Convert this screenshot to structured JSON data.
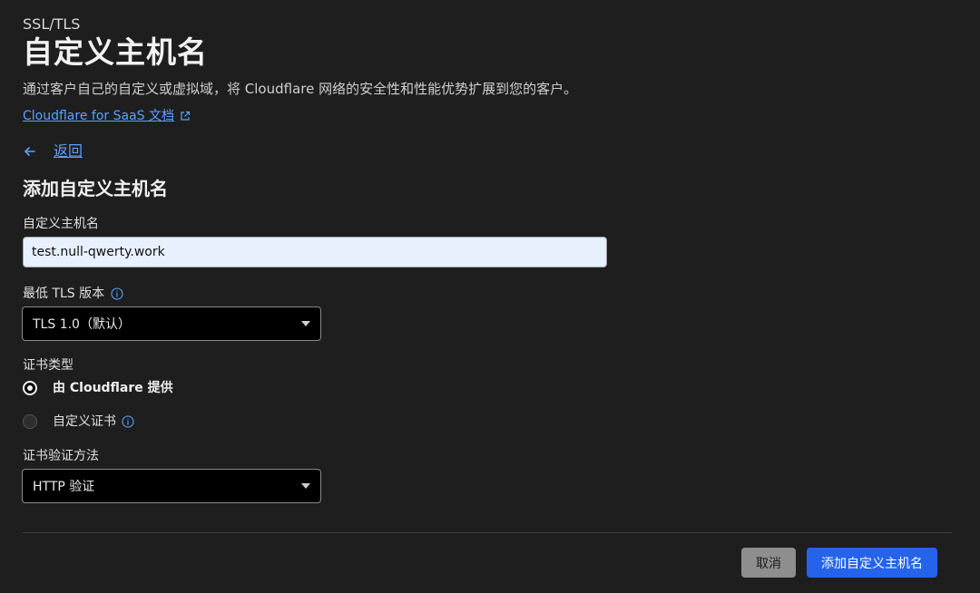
{
  "header": {
    "breadcrumb": "SSL/TLS",
    "title": "自定义主机名",
    "description": "通过客户自己的自定义或虚拟域，将 Cloudflare 网络的安全性和性能优势扩展到您的客户。",
    "doc_link": "Cloudflare for SaaS 文档"
  },
  "nav": {
    "back_label": "返回"
  },
  "form": {
    "section_title": "添加自定义主机名",
    "hostname": {
      "label": "自定义主机名",
      "value": "test.null-qwerty.work"
    },
    "min_tls": {
      "label": "最低 TLS 版本",
      "selected": "TLS 1.0（默认）"
    },
    "cert_type": {
      "label": "证书类型",
      "options": [
        {
          "label": "由 Cloudflare 提供",
          "checked": true
        },
        {
          "label": "自定义证书",
          "checked": false
        }
      ]
    },
    "validation": {
      "label": "证书验证方法",
      "selected": "HTTP 验证"
    }
  },
  "actions": {
    "cancel_label": "取消",
    "submit_label": "添加自定义主机名"
  },
  "colors": {
    "background": "#1e1e1f",
    "link": "#5aa2ff",
    "primary_button": "#2563eb",
    "secondary_button": "#8e8e8e"
  },
  "icons": [
    "external-link-icon",
    "arrow-left-icon",
    "info-icon",
    "chevron-down-icon"
  ]
}
